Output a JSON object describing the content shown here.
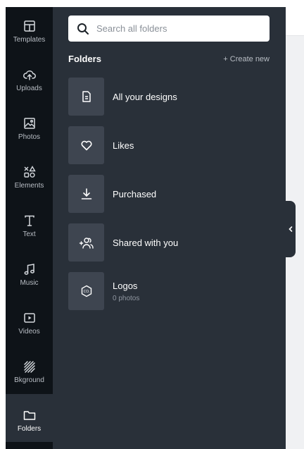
{
  "sidebar": {
    "tabs": [
      {
        "label": "Templates",
        "icon": "templates-icon"
      },
      {
        "label": "Uploads",
        "icon": "upload-cloud-icon"
      },
      {
        "label": "Photos",
        "icon": "image-icon"
      },
      {
        "label": "Elements",
        "icon": "shapes-icon"
      },
      {
        "label": "Text",
        "icon": "text-icon"
      },
      {
        "label": "Music",
        "icon": "music-note-icon"
      },
      {
        "label": "Videos",
        "icon": "video-icon"
      },
      {
        "label": "Bkground",
        "icon": "background-pattern-icon"
      },
      {
        "label": "Folders",
        "icon": "folder-icon"
      }
    ],
    "active_tab": "Folders"
  },
  "panel": {
    "search": {
      "placeholder": "Search all folders",
      "value": ""
    },
    "section_title": "Folders",
    "create_new_label": "+ Create new",
    "folders": [
      {
        "name": "All your designs",
        "icon": "document-icon",
        "subtitle": ""
      },
      {
        "name": "Likes",
        "icon": "heart-icon",
        "subtitle": ""
      },
      {
        "name": "Purchased",
        "icon": "download-icon",
        "subtitle": ""
      },
      {
        "name": "Shared with you",
        "icon": "shared-users-icon",
        "subtitle": ""
      },
      {
        "name": "Logos",
        "icon": "logo-badge-icon",
        "subtitle": "0 photos"
      }
    ]
  },
  "colors": {
    "rail_bg": "#0e1318",
    "panel_bg": "#293039",
    "tile_bg": "#3e4550",
    "text_primary": "#ffffff",
    "text_secondary": "#b8bdc4"
  }
}
